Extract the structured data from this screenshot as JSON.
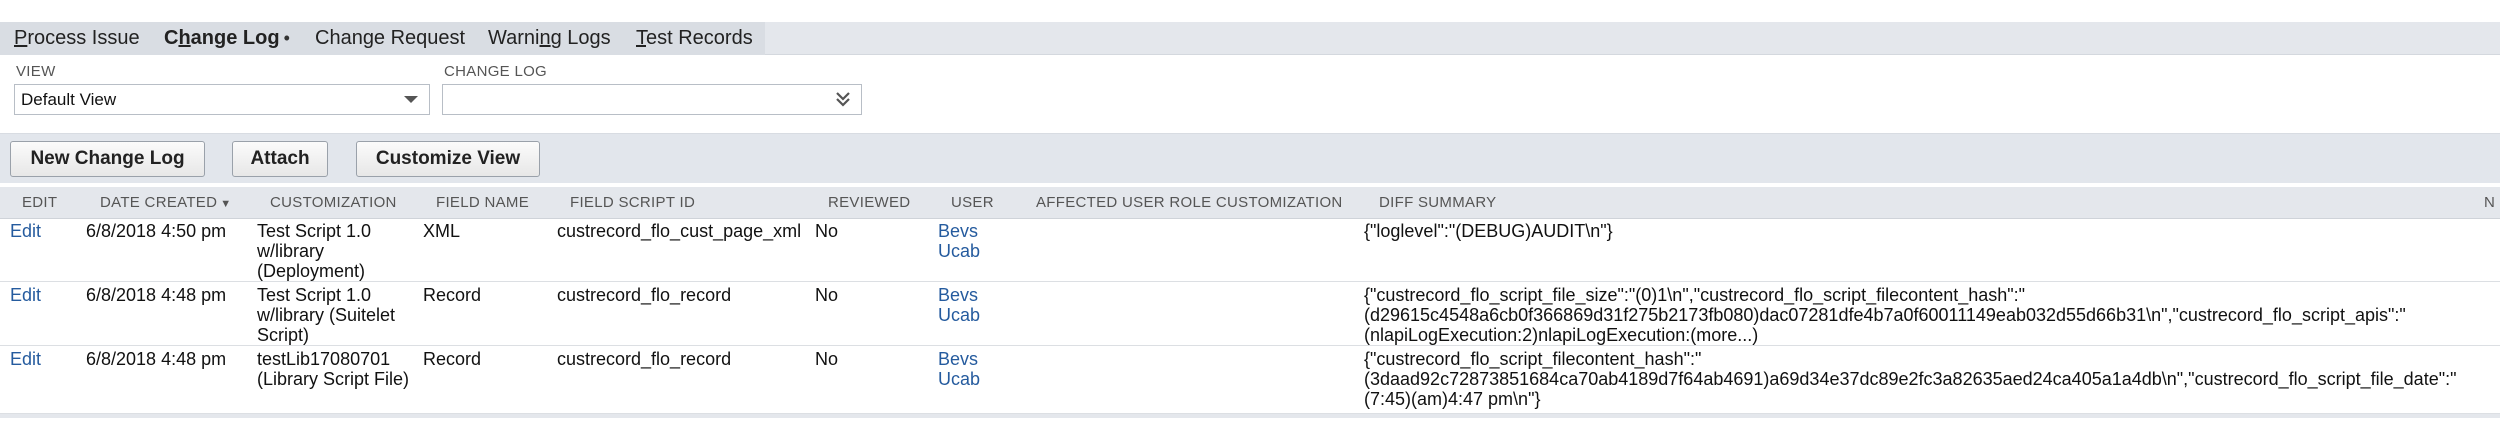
{
  "tabs": [
    {
      "label_pre": "",
      "label_u": "P",
      "label_post": "rocess Issue",
      "active": false
    },
    {
      "label_pre": "C",
      "label_u": "h",
      "label_post": "ange Log",
      "active": true,
      "dot": "•"
    },
    {
      "label_pre": "Change Request",
      "label_u": "",
      "label_post": "",
      "active": false
    },
    {
      "label_pre": "Warni",
      "label_u": "n",
      "label_post": "g Logs",
      "active": false
    },
    {
      "label_pre": "",
      "label_u": "T",
      "label_post": "est Records",
      "active": false
    }
  ],
  "filters": {
    "view_label": "VIEW",
    "view_value": "Default View",
    "changelog_label": "CHANGE LOG",
    "changelog_value": ""
  },
  "buttons": {
    "new_change_log": "New Change Log",
    "attach": "Attach",
    "customize_view": "Customize View"
  },
  "table": {
    "headers": {
      "edit": "EDIT",
      "date_created": "DATE CREATED",
      "sort_indicator": "▼",
      "customization": "CUSTOMIZATION",
      "field_name": "FIELD NAME",
      "field_script_id": "FIELD SCRIPT ID",
      "reviewed": "REVIEWED",
      "user": "USER",
      "affected_role": "AFFECTED USER ROLE CUSTOMIZATION",
      "diff_summary": "DIFF SUMMARY",
      "trailing": "N"
    },
    "rows": [
      {
        "edit": "Edit",
        "date": "6/8/2018 4:50 pm",
        "customization": [
          "Test Script 1.0",
          "w/library",
          "(Deployment)"
        ],
        "field_name": "XML",
        "field_script_id": "custrecord_flo_cust_page_xml",
        "reviewed": "No",
        "user": [
          "Bevs",
          "Ucab"
        ],
        "affected_role": "",
        "diff": [
          "{\"loglevel\":\"(DEBUG)AUDIT\\n\"}"
        ]
      },
      {
        "edit": "Edit",
        "date": "6/8/2018 4:48 pm",
        "customization": [
          "Test Script 1.0",
          "w/library (Suitelet",
          "Script)"
        ],
        "field_name": "Record",
        "field_script_id": "custrecord_flo_record",
        "reviewed": "No",
        "user": [
          "Bevs",
          "Ucab"
        ],
        "affected_role": "",
        "diff": [
          "{\"custrecord_flo_script_file_size\":\"(0)1\\n\",\"custrecord_flo_script_filecontent_hash\":\"",
          "(d29615c4548a6cb0f366869d31f275b2173fb080)dac07281dfe4b7a0f60011149eab032d55d66b31\\n\",\"custrecord_flo_script_apis\":\"",
          "(nlapiLogExecution:2)nlapiLogExecution:(more...)"
        ]
      },
      {
        "edit": "Edit",
        "date": "6/8/2018 4:48 pm",
        "customization": [
          "testLib17080701",
          "(Library Script File)"
        ],
        "field_name": "Record",
        "field_script_id": "custrecord_flo_record",
        "reviewed": "No",
        "user": [
          "Bevs",
          "Ucab"
        ],
        "affected_role": "",
        "diff": [
          "{\"custrecord_flo_script_filecontent_hash\":\"",
          "(3daad92c72873851684ca70ab4189d7f64ab4691)a69d34e37dc89e2fc3a82635aed24ca405a1a4db\\n\",\"custrecord_flo_script_file_date\":\"",
          "(7:45)(am)4:47 pm\\n\"}"
        ]
      }
    ]
  }
}
